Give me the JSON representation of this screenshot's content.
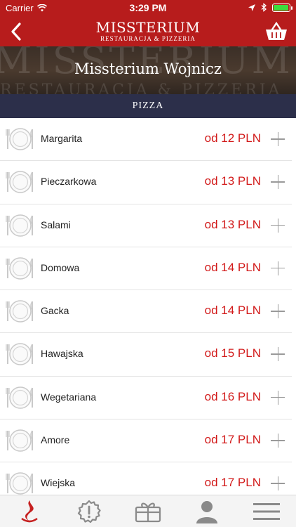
{
  "status_bar": {
    "carrier": "Carrier",
    "time": "3:29 PM",
    "battery_level": 0.95
  },
  "nav": {
    "logo_title": "MISSTERIUM",
    "logo_subtitle": "RESTAURACJA & PIZZERIA",
    "back_icon": "chevron-left-icon",
    "basket_icon": "basket-icon"
  },
  "hero": {
    "title": "Missterium Wojnicz",
    "background_text_line1": "MISSTERIUM",
    "background_text_line2": "RESTAURACJA & PIZZERIA"
  },
  "category": {
    "title": "PIZZA"
  },
  "menu_items": [
    {
      "name": "Margarita",
      "price": "od 12 PLN"
    },
    {
      "name": "Pieczarkowa",
      "price": "od 13 PLN"
    },
    {
      "name": "Salami",
      "price": "od 13 PLN"
    },
    {
      "name": "Domowa",
      "price": "od 14 PLN"
    },
    {
      "name": "Gacka",
      "price": "od 14 PLN"
    },
    {
      "name": "Hawajska",
      "price": "od 15 PLN"
    },
    {
      "name": "Wegetariana",
      "price": "od 16 PLN"
    },
    {
      "name": "Amore",
      "price": "od 17 PLN"
    },
    {
      "name": "Wiejska",
      "price": "od 17 PLN"
    }
  ],
  "tab_bar": {
    "tabs": [
      {
        "icon": "flame-logo-icon"
      },
      {
        "icon": "alert-badge-icon"
      },
      {
        "icon": "gift-icon"
      },
      {
        "icon": "user-icon"
      },
      {
        "icon": "menu-icon"
      }
    ]
  },
  "colors": {
    "header_red": "#b71c1c",
    "category_navy": "#2c2f4a",
    "price_red": "#d21a1a"
  }
}
